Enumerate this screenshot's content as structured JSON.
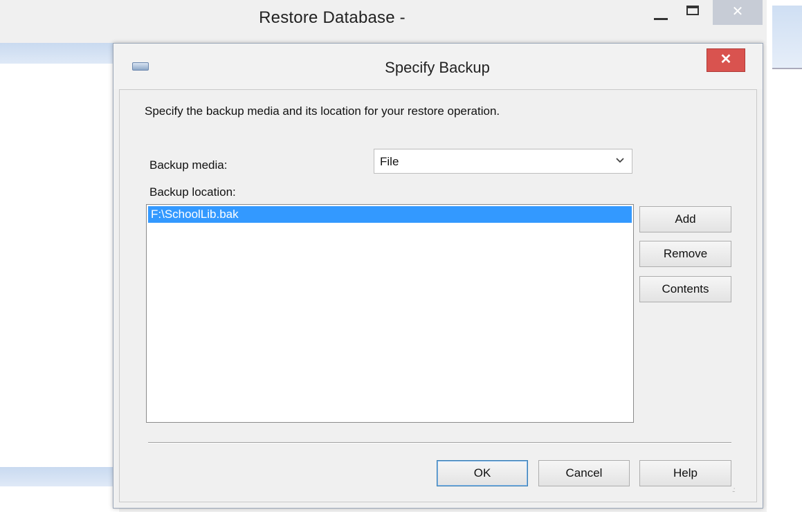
{
  "background_window": {
    "title": "Restore Database -",
    "controls": {
      "minimize_label": "minimize",
      "maximize_label": "maximize",
      "close_label": "✕"
    }
  },
  "dialog": {
    "title": "Specify Backup",
    "close_label": "✕",
    "description": "Specify the backup media and its location for your restore operation.",
    "backup_media": {
      "label": "Backup media:",
      "value": "File"
    },
    "backup_location": {
      "label": "Backup location:",
      "items": [
        "F:\\SchoolLib.bak"
      ],
      "selected_index": 0
    },
    "side_buttons": {
      "add": "Add",
      "remove": "Remove",
      "contents": "Contents"
    },
    "footer_buttons": {
      "ok": "OK",
      "cancel": "Cancel",
      "help": "Help"
    }
  },
  "colors": {
    "selection": "#3399ff",
    "close_button": "#d9534f",
    "dialog_background": "#f0f0f0"
  },
  "icons": [
    "app-icon",
    "close-icon",
    "minimize-icon",
    "maximize-icon",
    "chevron-down-icon",
    "resize-grip-icon"
  ]
}
